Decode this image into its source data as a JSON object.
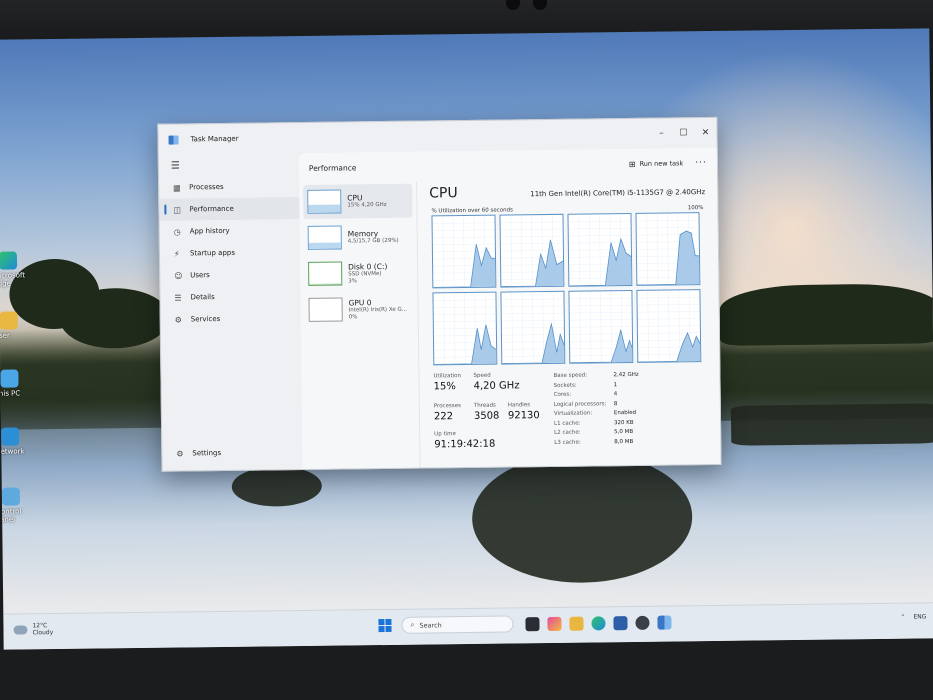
{
  "window": {
    "title": "Task Manager",
    "controls": [
      "–",
      "☐",
      "✕"
    ]
  },
  "nav": {
    "menu_icon": "☰",
    "items": [
      {
        "label": "Processes",
        "icon": "processes-icon",
        "active": false
      },
      {
        "label": "Performance",
        "icon": "performance-icon",
        "active": true
      },
      {
        "label": "App history",
        "icon": "app-history-icon",
        "active": false
      },
      {
        "label": "Startup apps",
        "icon": "startup-icon",
        "active": false
      },
      {
        "label": "Users",
        "icon": "users-icon",
        "active": false
      },
      {
        "label": "Details",
        "icon": "details-icon",
        "active": false
      },
      {
        "label": "Services",
        "icon": "services-icon",
        "active": false
      }
    ],
    "settings_label": "Settings"
  },
  "header": {
    "title": "Performance",
    "run_new_task": "Run new task",
    "more": "···"
  },
  "perf_list": [
    {
      "name": "CPU",
      "sub1": "15% 4,20 GHz",
      "sub2": ""
    },
    {
      "name": "Memory",
      "sub1": "4,5/15,7 GB (29%)",
      "sub2": ""
    },
    {
      "name": "Disk 0 (C:)",
      "sub1": "SSD (NVMe)",
      "sub2": "3%"
    },
    {
      "name": "GPU 0",
      "sub1": "Intel(R) Iris(R) Xe G...",
      "sub2": "0%"
    }
  ],
  "cpu": {
    "title": "CPU",
    "model": "11th Gen Intel(R) Core(TM) i5-1135G7 @ 2.40GHz",
    "util_label": "% Utilization over 60 seconds",
    "util_max": "100%",
    "utilization_label": "Utilization",
    "utilization": "15%",
    "speed_label": "Speed",
    "speed": "4,20 GHz",
    "processes_label": "Processes",
    "processes": "222",
    "threads_label": "Threads",
    "threads": "3508",
    "handles_label": "Handles",
    "handles": "92130",
    "uptime_label": "Up time",
    "uptime": "91:19:42:18",
    "specs": [
      {
        "k": "Base speed:",
        "v": "2,42 GHz"
      },
      {
        "k": "Sockets:",
        "v": "1"
      },
      {
        "k": "Cores:",
        "v": "4"
      },
      {
        "k": "Logical processors:",
        "v": "8"
      },
      {
        "k": "Virtualization:",
        "v": "Enabled"
      },
      {
        "k": "L1 cache:",
        "v": "320 KB"
      },
      {
        "k": "L2 cache:",
        "v": "5,0 MB"
      },
      {
        "k": "L3 cache:",
        "v": "8,0 MB"
      }
    ]
  },
  "desktop_icons": [
    "Microsoft Edge",
    "User",
    "This PC",
    "Network",
    "Control Panel"
  ],
  "taskbar": {
    "temperature": "12°C",
    "weather": "Cloudy",
    "search_placeholder": "Search",
    "language": "ENG"
  },
  "colors": {
    "accent": "#2b6cc4",
    "graph_line": "#4f8cc9",
    "graph_fill": "#a9cbe9"
  }
}
